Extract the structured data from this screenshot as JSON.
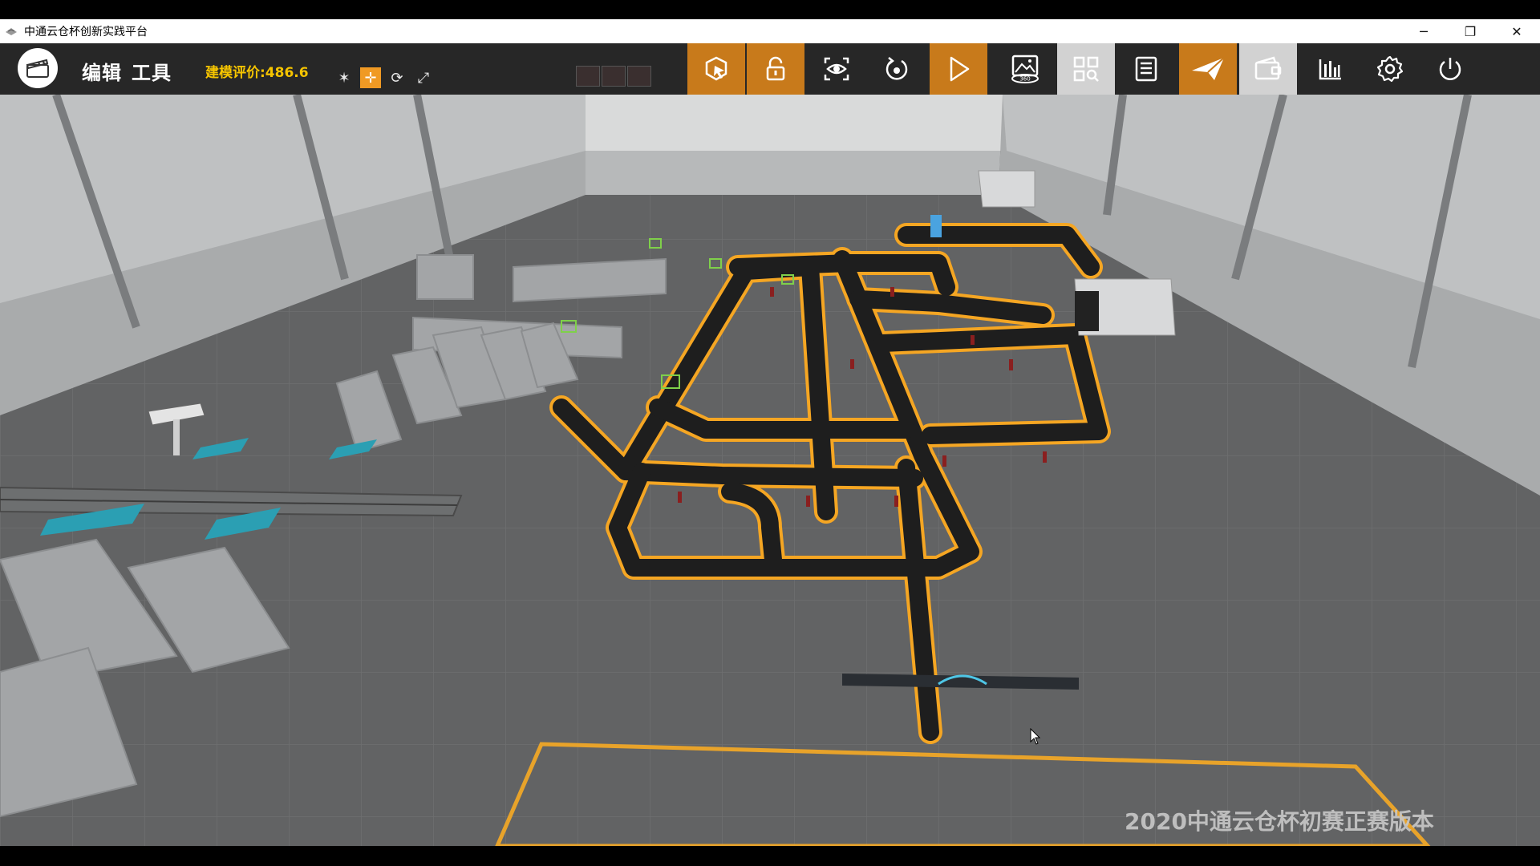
{
  "window": {
    "title": "中通云仓杯创新实践平台",
    "controls": {
      "minimize": "─",
      "restore": "❐",
      "close": "✕"
    }
  },
  "toolbar": {
    "menu": {
      "edit": "编辑",
      "tools": "工具"
    },
    "score_text": "建模评价:486.6",
    "small_tools": [
      {
        "name": "scatter-tool",
        "glyph": "✶",
        "active": false
      },
      {
        "name": "move-tool",
        "glyph": "✛",
        "active": true
      },
      {
        "name": "rotate-tool",
        "glyph": "⟳",
        "active": false
      },
      {
        "name": "scale-tool",
        "glyph": "⤢",
        "active": false
      }
    ],
    "buttons": [
      {
        "name": "select-object-button",
        "icon": "cube-cursor-icon",
        "style": "orange"
      },
      {
        "name": "lock-button",
        "icon": "lock-icon",
        "style": "orange"
      },
      {
        "name": "focus-view-button",
        "icon": "eye-icon",
        "style": "dark"
      },
      {
        "name": "reset-view-button",
        "icon": "rotate-icon",
        "style": "dark"
      },
      {
        "name": "play-button",
        "icon": "play-icon",
        "style": "orange"
      },
      {
        "name": "view-360-button",
        "icon": "panorama-360-icon",
        "style": "dark"
      },
      {
        "name": "grid-search-button",
        "icon": "grid-search-icon",
        "style": "light"
      },
      {
        "name": "list-button",
        "icon": "list-icon",
        "style": "dark"
      },
      {
        "name": "submit-button",
        "icon": "paper-plane-icon",
        "style": "orange"
      },
      {
        "name": "wallet-button",
        "icon": "wallet-icon",
        "style": "light"
      },
      {
        "name": "statistics-button",
        "icon": "bar-chart-icon",
        "style": "dark"
      },
      {
        "name": "settings-button",
        "icon": "gear-icon",
        "style": "dark"
      },
      {
        "name": "power-button",
        "icon": "power-icon",
        "style": "dark"
      }
    ],
    "view_360_label": "360"
  },
  "scene": {
    "watermark": "2020中通云仓杯初赛正赛版本",
    "colors": {
      "floor": "#5f6061",
      "wall": "#aeb0b1",
      "conveyor": "#1c1c1c",
      "conveyor_edge": "#f5a623",
      "zone_outline": "#e8a32a",
      "shelf": "#b4b6b8",
      "workstation": "#2b9fb3"
    }
  }
}
